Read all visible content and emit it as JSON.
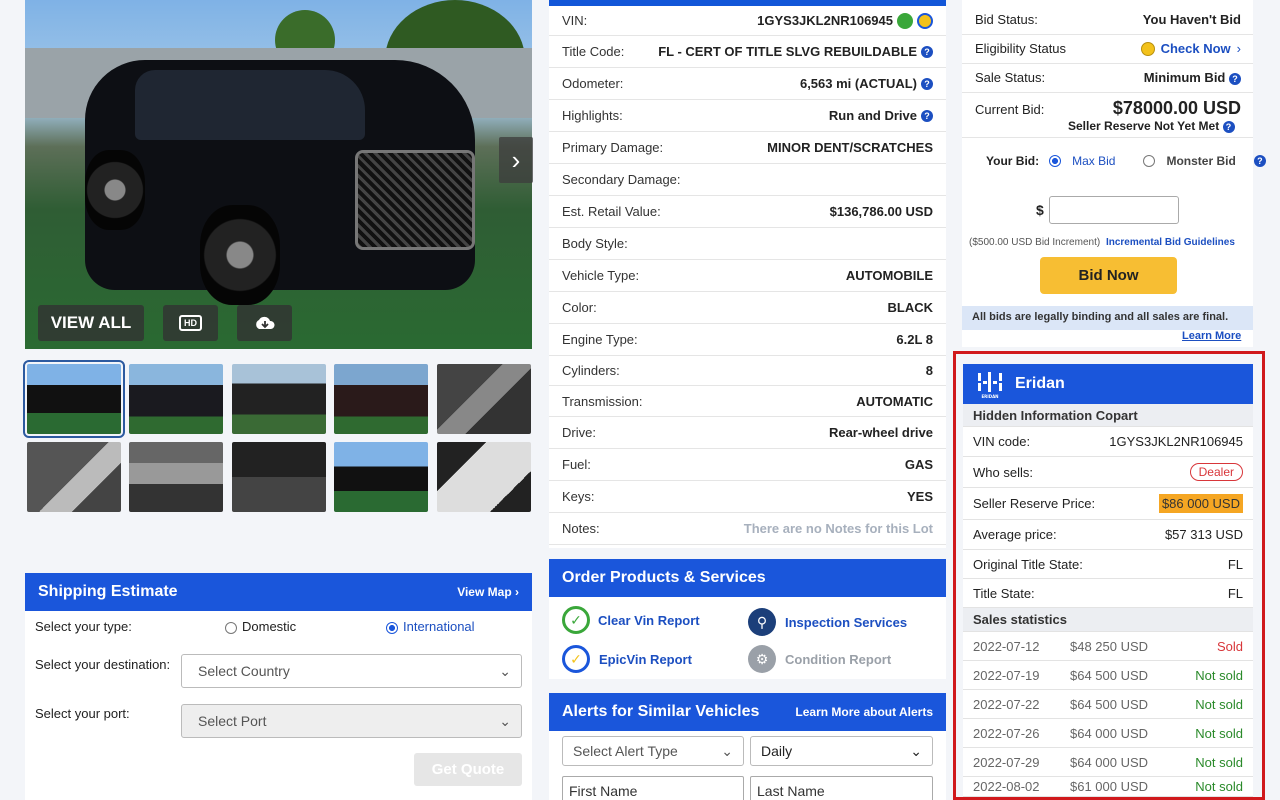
{
  "photo": {
    "view_all": "VIEW ALL",
    "hd": "HD",
    "thumbs_count_note": ""
  },
  "details": {
    "rows": [
      {
        "label": "VIN:",
        "value": "1GYS3JKL2NR106945"
      },
      {
        "label": "Title Code:",
        "value": "FL - CERT OF TITLE SLVG REBUILDABLE"
      },
      {
        "label": "Odometer:",
        "value": "6,563 mi (ACTUAL)"
      },
      {
        "label": "Highlights:",
        "value": "Run and Drive"
      },
      {
        "label": "Primary Damage:",
        "value": "MINOR DENT/SCRATCHES"
      },
      {
        "label": "Secondary Damage:",
        "value": ""
      },
      {
        "label": "Est. Retail Value:",
        "value": "$136,786.00 USD"
      },
      {
        "label": "Body Style:",
        "value": ""
      },
      {
        "label": "Vehicle Type:",
        "value": "AUTOMOBILE"
      },
      {
        "label": "Color:",
        "value": "BLACK"
      },
      {
        "label": "Engine Type:",
        "value": "6.2L 8"
      },
      {
        "label": "Cylinders:",
        "value": "8"
      },
      {
        "label": "Transmission:",
        "value": "AUTOMATIC"
      },
      {
        "label": "Drive:",
        "value": "Rear-wheel drive"
      },
      {
        "label": "Fuel:",
        "value": "GAS"
      },
      {
        "label": "Keys:",
        "value": "YES"
      },
      {
        "label": "Notes:",
        "value": "There are no Notes for this Lot"
      }
    ]
  },
  "bid": {
    "bid_status_label": "Bid Status:",
    "bid_status_value": "You Haven't Bid",
    "eligibility_label": "Eligibility Status",
    "eligibility_value": "Check Now",
    "sale_status_label": "Sale Status:",
    "sale_status_value": "Minimum Bid",
    "current_bid_label": "Current Bid:",
    "current_bid_value": "$78000.00 USD",
    "reserve_note": "Seller Reserve Not Yet Met",
    "your_bid_label": "Your Bid:",
    "max_bid": "Max Bid",
    "monster_bid": "Monster Bid",
    "currency_symbol": "$",
    "increment_note": "($500.00 USD Bid Increment)",
    "guidelines_link": "Incremental Bid Guidelines",
    "bid_now": "Bid Now",
    "legal_note": "All bids are legally binding and all sales are final.",
    "learn_more": "Learn More"
  },
  "eridan": {
    "title": "Eridan",
    "logo_text": "ERIDAN",
    "hidden_header": "Hidden Information Copart",
    "rows": [
      {
        "label": "VIN code:",
        "value": "1GYS3JKL2NR106945"
      },
      {
        "label": "Who sells:",
        "value": "Dealer"
      },
      {
        "label": "Seller Reserve Price:",
        "value": "$86 000 USD"
      },
      {
        "label": "Average price:",
        "value": "$57 313 USD"
      },
      {
        "label": "Original Title State:",
        "value": "FL"
      },
      {
        "label": "Title State:",
        "value": "FL"
      }
    ],
    "sales_header": "Sales statistics",
    "sales": [
      {
        "date": "2022-07-12",
        "price": "$48 250 USD",
        "status": "Sold"
      },
      {
        "date": "2022-07-19",
        "price": "$64 500 USD",
        "status": "Not sold"
      },
      {
        "date": "2022-07-22",
        "price": "$64 500 USD",
        "status": "Not sold"
      },
      {
        "date": "2022-07-26",
        "price": "$64 000 USD",
        "status": "Not sold"
      },
      {
        "date": "2022-07-29",
        "price": "$64 000 USD",
        "status": "Not sold"
      },
      {
        "date": "2022-08-02",
        "price": "$61 000 USD",
        "status": "Not sold"
      }
    ],
    "colors": {
      "sold": "#d8363a",
      "not_sold": "#2a8a2a",
      "header": "#1a56db",
      "highlight": "#f5a623"
    }
  },
  "shipping": {
    "title": "Shipping Estimate",
    "view_map": "View Map",
    "type_label": "Select your type:",
    "domestic": "Domestic",
    "international": "International",
    "destination_label": "Select your destination:",
    "country_placeholder": "Select Country",
    "port_label": "Select your port:",
    "port_placeholder": "Select Port",
    "get_quote": "Get Quote"
  },
  "order": {
    "title": "Order Products & Services",
    "clear_vin": "Clear Vin Report",
    "inspection": "Inspection Services",
    "epic_vin": "EpicVin Report",
    "condition": "Condition Report"
  },
  "alerts": {
    "title": "Alerts for Similar Vehicles",
    "learn_more": "Learn More about Alerts",
    "alert_type": "Select Alert Type",
    "frequency": "Daily",
    "first_name": "First Name",
    "last_name": "Last Name"
  }
}
